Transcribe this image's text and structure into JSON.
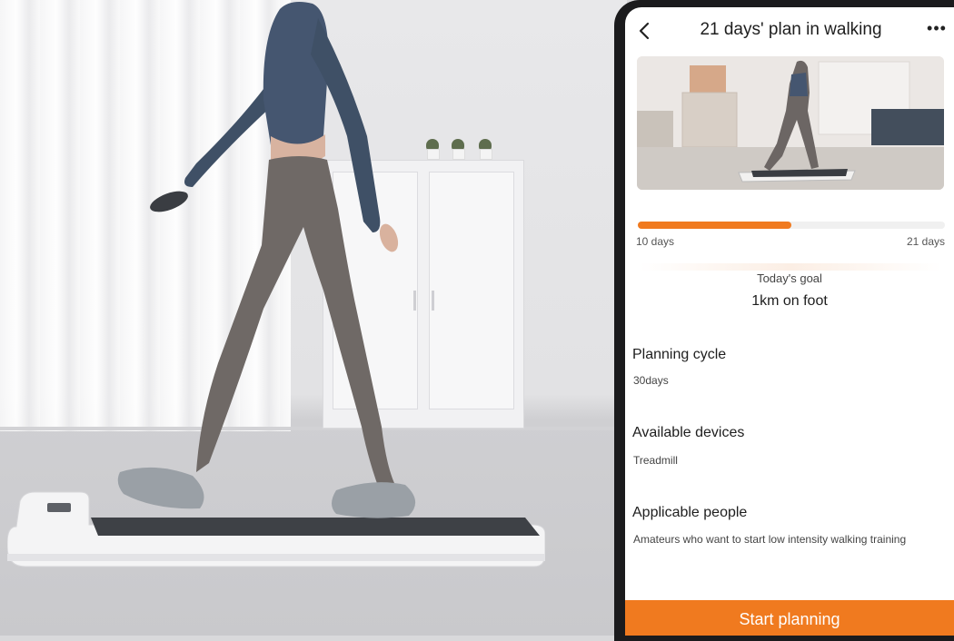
{
  "app": {
    "title": "21 days' plan in walking"
  },
  "plan": {
    "progress_fraction": 0.5,
    "start_label": "10 days",
    "end_label": "21 days",
    "goal_label": "Today's goal",
    "goal_value": "1km on foot"
  },
  "sections": [
    {
      "title": "Planning cycle",
      "value": "30days"
    },
    {
      "title": "Available devices",
      "value": "Treadmill"
    },
    {
      "title": "Applicable people",
      "value": "Amateurs who want to start low intensity walking training"
    }
  ],
  "actions": {
    "start_label": "Start planning"
  },
  "icons": {
    "back": "chevron-left-icon",
    "more": "more-horizontal-icon"
  },
  "colors": {
    "accent": "#f07a1f",
    "text": "#1e1e1e",
    "muted": "#555555"
  }
}
